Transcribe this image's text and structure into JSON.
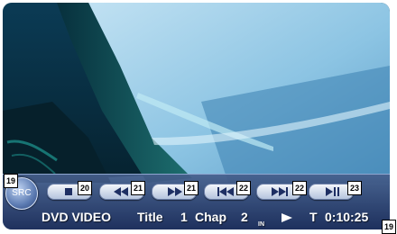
{
  "colors": {
    "control_bar": "#2e4a86",
    "button_face": "#e6ecf6",
    "button_icon": "#1e2f63",
    "text": "#ffffff",
    "callout_bg": "#ffffff"
  },
  "controls": {
    "src_label": "SRC",
    "buttons": [
      {
        "icon": "stop-icon",
        "callout": "20"
      },
      {
        "icon": "rewind-icon",
        "callout": "21"
      },
      {
        "icon": "fast-forward-icon",
        "callout": "21"
      },
      {
        "icon": "previous-chapter-icon",
        "callout": "22"
      },
      {
        "icon": "next-chapter-icon",
        "callout": "22"
      },
      {
        "icon": "play-pause-icon",
        "callout": "23"
      }
    ]
  },
  "callouts": {
    "src": "19",
    "time": "19"
  },
  "status": {
    "source": "DVD VIDEO",
    "title_label": "Title",
    "title_number": "1",
    "chapter_label": "Chap",
    "chapter_number": "2",
    "in_label": "IN",
    "play_state_icon": "play-icon",
    "time_prefix": "T",
    "time": "0:10:25"
  }
}
